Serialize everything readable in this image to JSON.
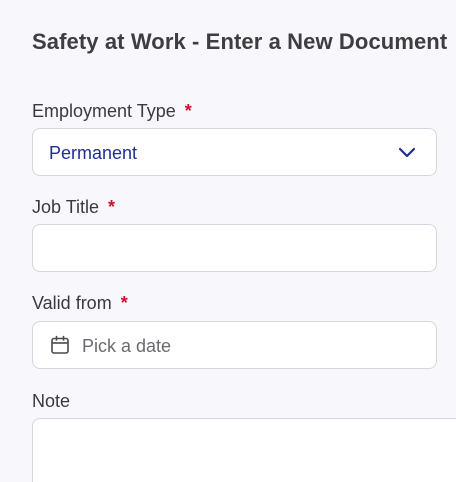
{
  "header": {
    "title": "Safety at Work - Enter a New Document"
  },
  "form": {
    "employment_type": {
      "label": "Employment Type",
      "required_mark": "*",
      "value": "Permanent"
    },
    "job_title": {
      "label": "Job Title",
      "required_mark": "*",
      "value": ""
    },
    "valid_from": {
      "label": "Valid from",
      "required_mark": "*",
      "placeholder": "Pick a date"
    },
    "note": {
      "label": "Note",
      "value": ""
    }
  },
  "icons": {
    "dropdown": "chevron-down-icon",
    "date": "calendar-icon"
  },
  "colors": {
    "required": "#c8102e",
    "select_value": "#1e2f8f",
    "background": "#f8f7fc"
  }
}
